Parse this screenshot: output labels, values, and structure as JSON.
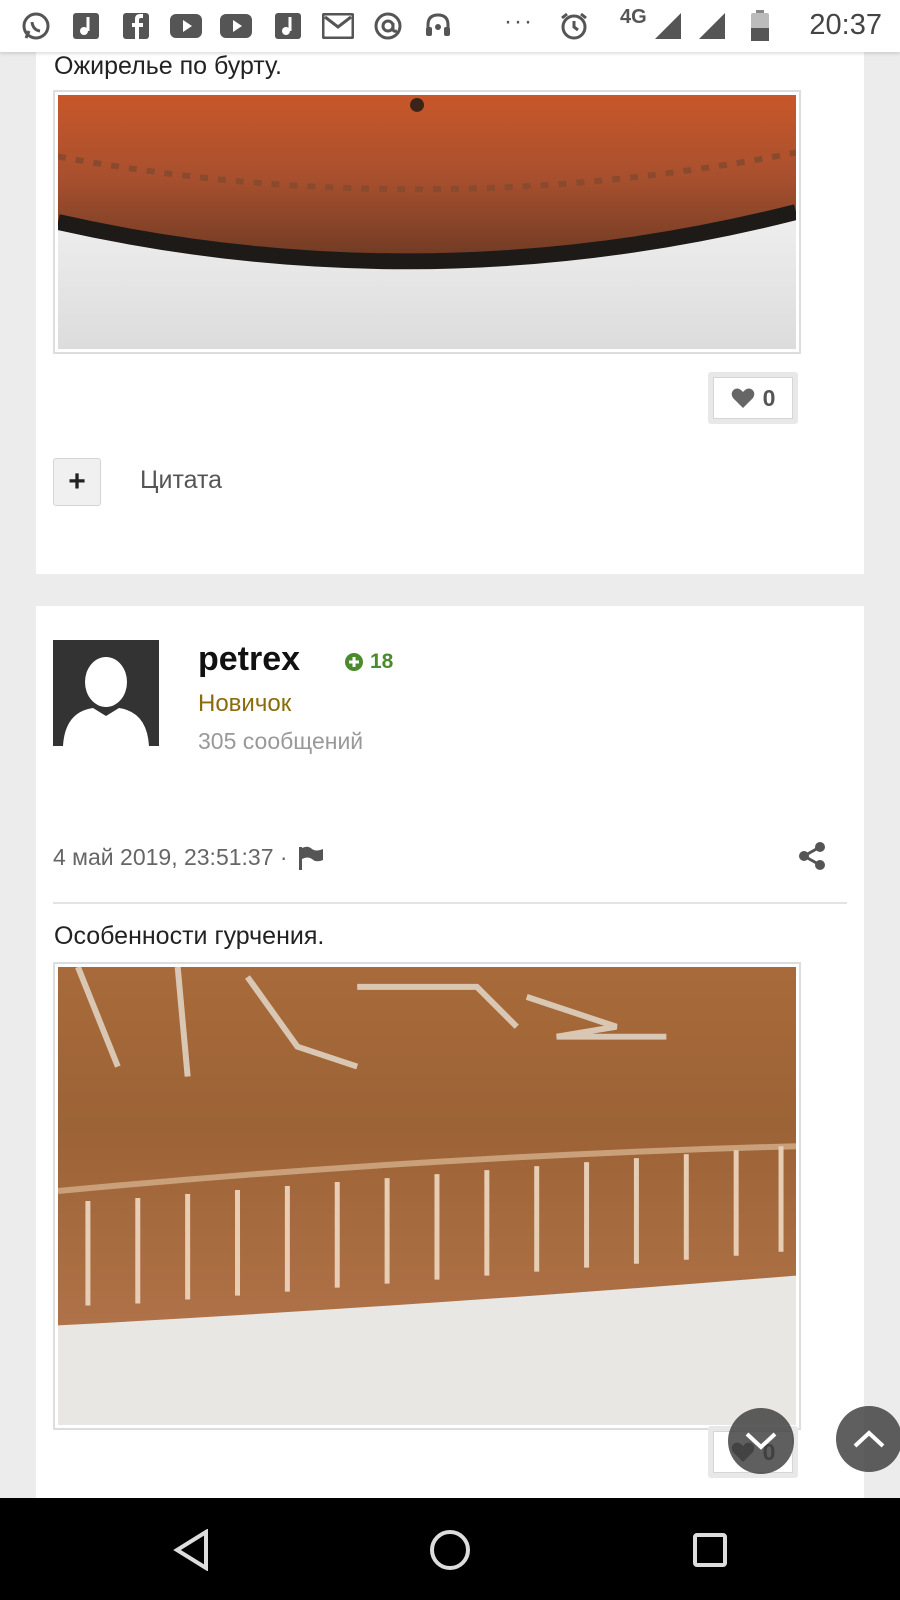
{
  "status_bar": {
    "time": "20:37",
    "network": "4G",
    "overflow": "···",
    "icons": [
      "whatsapp-icon",
      "music-icon",
      "facebook-icon",
      "youtube-icon",
      "youtube-icon",
      "music-icon",
      "gmail-icon",
      "email-icon",
      "headset-icon",
      "alarm-icon",
      "signal-icon",
      "signal-icon",
      "battery-icon"
    ]
  },
  "post1": {
    "caption": "Ожирелье по бурту.",
    "image_icon": "coin-edge-photo",
    "likes": "0",
    "quote_label": "Цитата",
    "plus_label": "+"
  },
  "post2": {
    "author": "petrex",
    "reputation": "18",
    "rank": "Новичок",
    "post_count": "305 сообщений",
    "date": "4 май 2019, 23:51:37 ·",
    "caption": "Особенности гурчения.",
    "image_icon": "coin-reeding-photo",
    "likes": "0"
  },
  "colors": {
    "accent_green": "#4b8b2d",
    "rank_gold": "#8a6d0b",
    "card_bg": "#ffffff",
    "page_bg": "#ececec"
  }
}
